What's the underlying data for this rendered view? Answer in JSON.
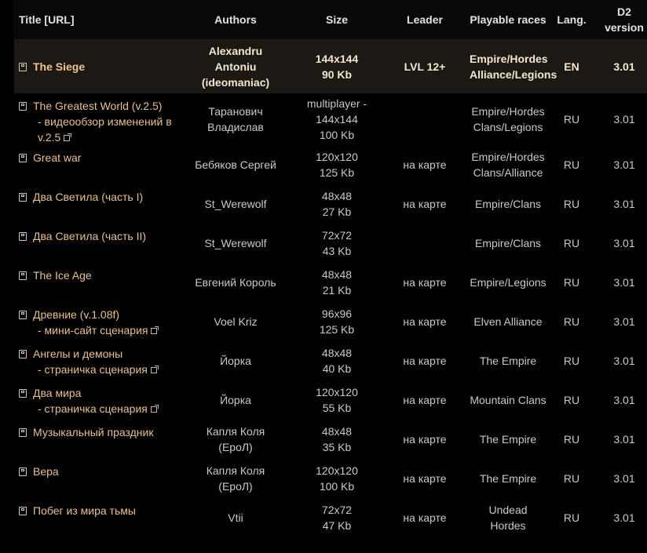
{
  "headers": {
    "title": "Title [URL]",
    "authors": "Authors",
    "size": "Size",
    "leader": "Leader",
    "races": "Playable races",
    "lang": "Lang.",
    "version": [
      "D2",
      "version"
    ]
  },
  "rows": [
    {
      "title": "The Siege",
      "authors": [
        "Alexandru",
        "Antoniu",
        "(ideomaniac)"
      ],
      "size": [
        "144x144",
        "90 Kb"
      ],
      "leader": "LVL 12+",
      "races": [
        "Empire/Hordes",
        "Alliance/Legions"
      ],
      "lang": "EN",
      "version": "3.01"
    },
    {
      "title": "The Greatest World (v.2.5)",
      "link": "- видеообзор изменений в v.2.5",
      "authors": [
        "Таранович",
        "Владислав"
      ],
      "size": [
        "multiplayer -",
        "144x144",
        "100 Kb"
      ],
      "leader": "",
      "races": [
        "Empire/Hordes",
        "Clans/Legions"
      ],
      "lang": "RU",
      "version": "3.01"
    },
    {
      "title": "Great war",
      "authors": [
        "Бебяков Сергей"
      ],
      "size": [
        "120x120",
        "125 Kb"
      ],
      "leader": "на карте",
      "races": [
        "Empire/Hordes",
        "Clans/Alliance"
      ],
      "lang": "RU",
      "version": "3.01"
    },
    {
      "title": "Два Светила (часть I)",
      "authors": [
        "St_Werewolf"
      ],
      "size": [
        "48x48",
        "27 Kb"
      ],
      "leader": "на карте",
      "races": [
        "Empire/Clans"
      ],
      "lang": "RU",
      "version": "3.01"
    },
    {
      "title": "Два Светила (часть II)",
      "authors": [
        "St_Werewolf"
      ],
      "size": [
        "72x72",
        "43 Kb"
      ],
      "leader": "",
      "races": [
        "Empire/Clans"
      ],
      "lang": "RU",
      "version": "3.01"
    },
    {
      "title": "The Ice Age",
      "authors": [
        "Евгений Король"
      ],
      "size": [
        "48x48",
        "21 Kb"
      ],
      "leader": "на карте",
      "races": [
        "Empire/Legions"
      ],
      "lang": "RU",
      "version": "3.01"
    },
    {
      "title": "Древние (v.1.08f)",
      "link": "- мини-сайт сценария",
      "authors": [
        "Voel Kriz"
      ],
      "size": [
        "96x96",
        "125 Kb"
      ],
      "leader": "на карте",
      "races": [
        "Elven Alliance"
      ],
      "lang": "RU",
      "version": "3.01"
    },
    {
      "title": "Ангелы и демоны",
      "link": "- страничка сценария",
      "authors": [
        "Йорка"
      ],
      "size": [
        "48x48",
        "40 Kb"
      ],
      "leader": "на карте",
      "races": [
        "The Empire"
      ],
      "lang": "RU",
      "version": "3.01"
    },
    {
      "title": "Два мира",
      "link": "- страничка сценария",
      "authors": [
        "Йорка"
      ],
      "size": [
        "120x120",
        "55 Kb"
      ],
      "leader": "на карте",
      "races": [
        "Mountain Clans"
      ],
      "lang": "RU",
      "version": "3.01"
    },
    {
      "title": "Музыкальный праздник",
      "authors": [
        "Капля Коля",
        "(ЕроЛ)"
      ],
      "size": [
        "48x48",
        "35 Kb"
      ],
      "leader": "на карте",
      "races": [
        "The Empire"
      ],
      "lang": "RU",
      "version": "3.01"
    },
    {
      "title": "Вера",
      "authors": [
        "Капля Коля",
        "(ЕроЛ)"
      ],
      "size": [
        "120x120",
        "100 Kb"
      ],
      "leader": "на карте",
      "races": [
        "The Empire"
      ],
      "lang": "RU",
      "version": "3.01"
    },
    {
      "title": "Побег из мира тьмы",
      "authors": [
        "Vtii"
      ],
      "size": [
        "72x72",
        "47 Kb"
      ],
      "leader": "на карте",
      "races": [
        "Undead Hordes"
      ],
      "lang": "RU",
      "version": "3.01"
    }
  ]
}
